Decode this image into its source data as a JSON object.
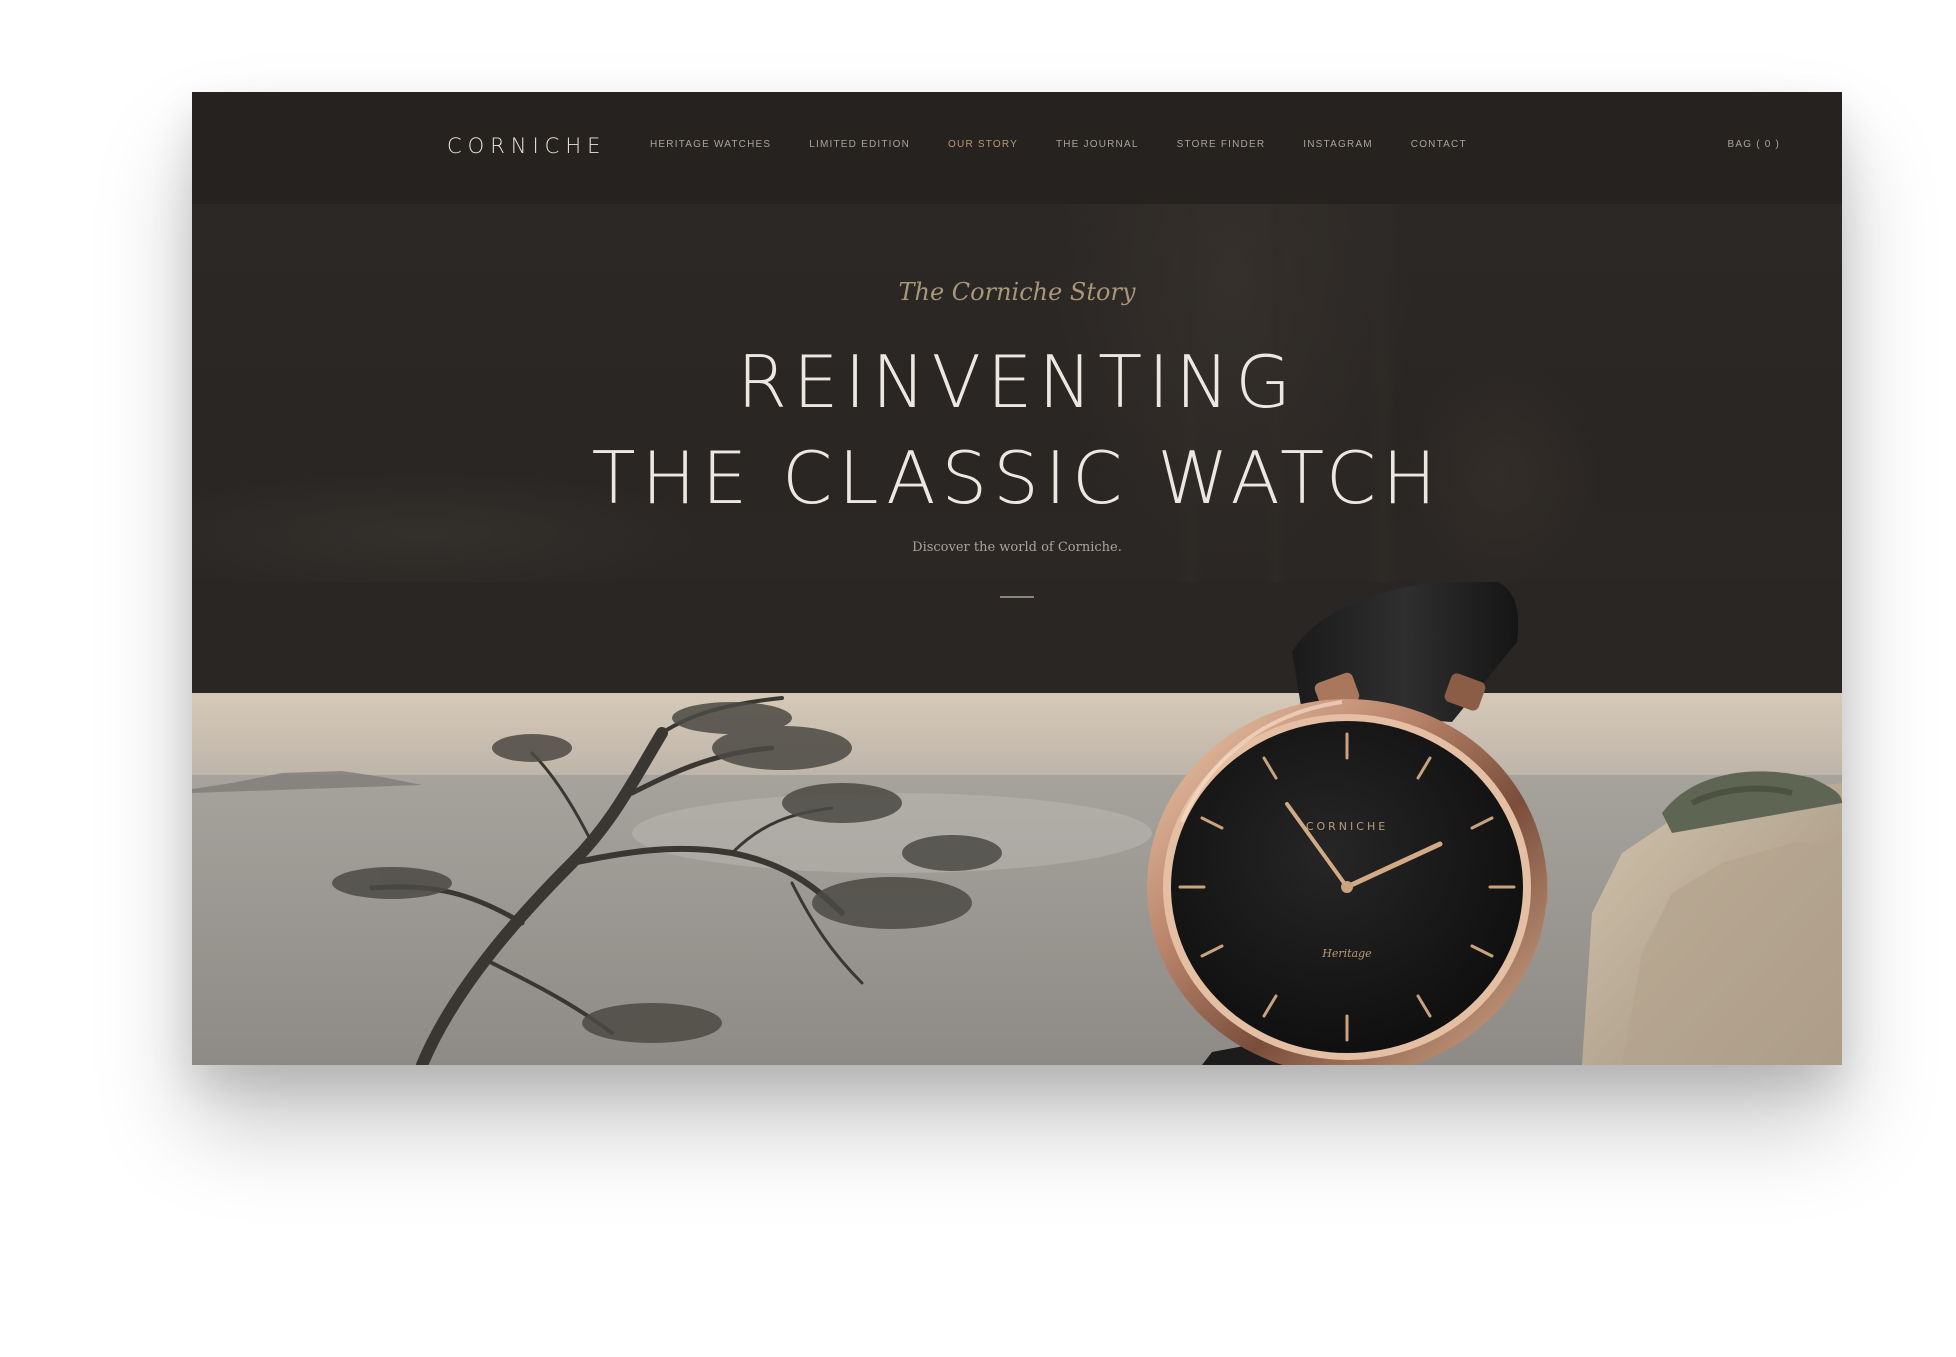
{
  "brand": {
    "logo": "CORNICHE"
  },
  "nav": {
    "items": [
      {
        "label": "HERITAGE WATCHES"
      },
      {
        "label": "LIMITED EDITION"
      },
      {
        "label": "OUR STORY",
        "active": true
      },
      {
        "label": "THE JOURNAL"
      },
      {
        "label": "STORE FINDER"
      },
      {
        "label": "INSTAGRAM"
      },
      {
        "label": "CONTACT"
      }
    ],
    "cart": "BAG ( 0 )"
  },
  "hero": {
    "kicker": "The Corniche Story",
    "headline_line1": "REINVENTING",
    "headline_line2": "THE CLASSIC WATCH",
    "subtext": "Discover the world of Corniche."
  },
  "watch": {
    "dial_brand": "CORNICHE",
    "dial_sub": "Heritage"
  },
  "colors": {
    "background_dark": "#2a2624",
    "nav_bg": "#262220",
    "accent_gold": "#b89b6e",
    "headline": "#ece7e0",
    "rose_gold_case": "#c99a7a",
    "dial": "#141414"
  },
  "icons": [
    "watch-image",
    "landscape-image"
  ]
}
